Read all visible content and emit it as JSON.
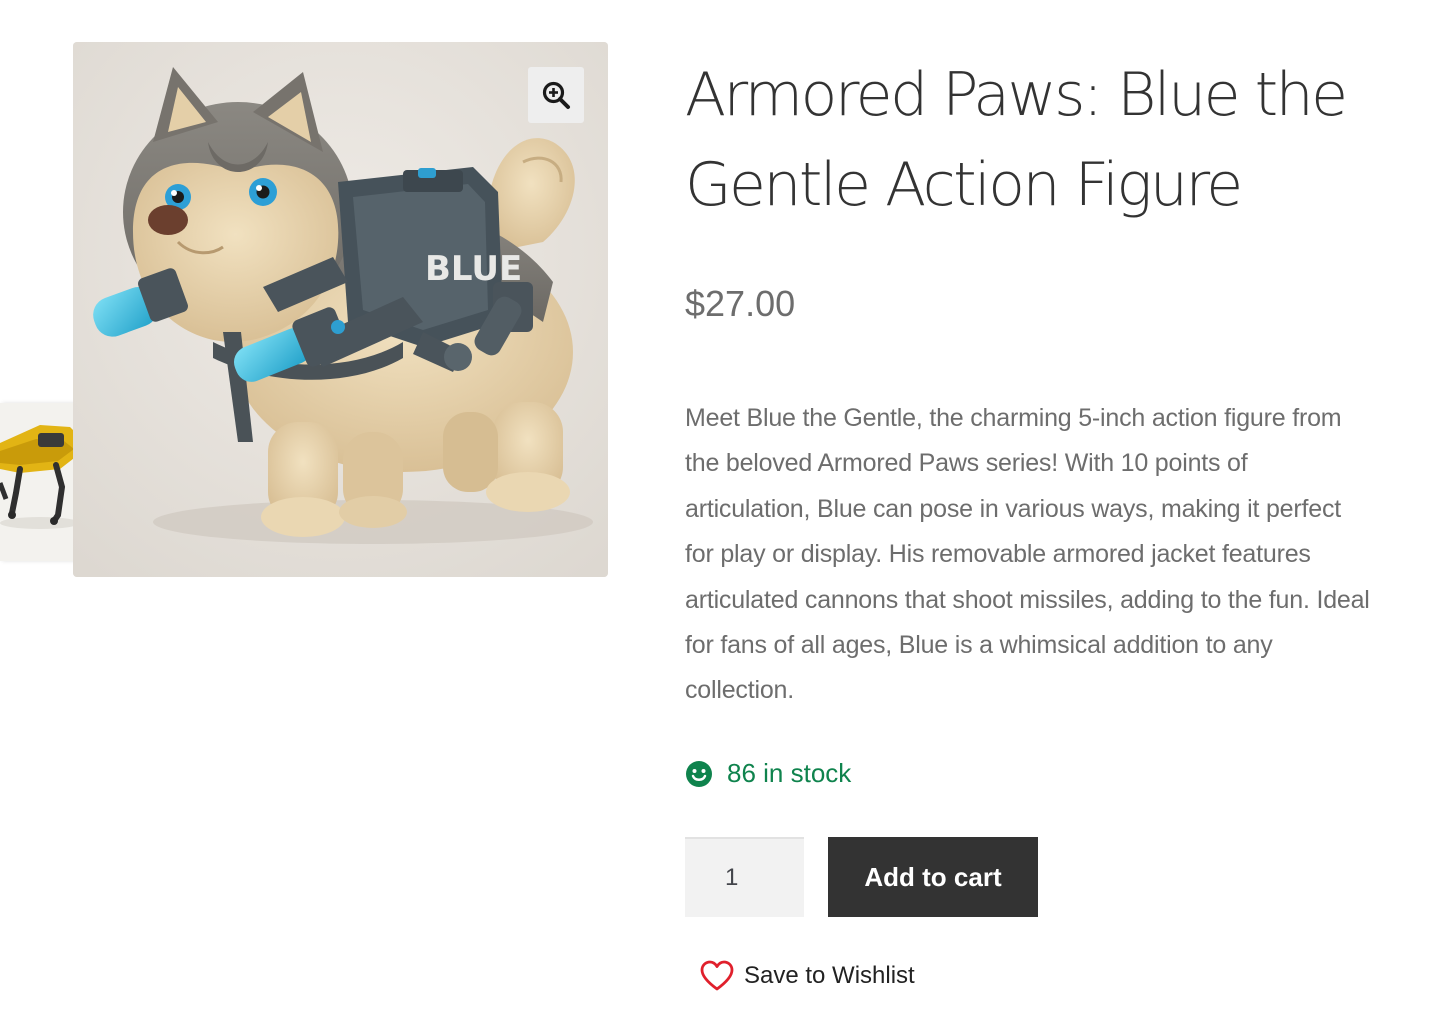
{
  "product": {
    "title": "Armored Paws: Blue the Gentle Action Figure",
    "price": "$27.00",
    "description": "Meet Blue the Gentle, the charming 5-inch action figure from the beloved Armored Paws series! With 10 points of articulation, Blue can pose in various ways, making it perfect for play or display. His removable armored jacket features articulated cannons that shoot missiles, adding to the fun. Ideal for fans of all ages, Blue is a whimsical addition to any collection.",
    "stock": "86 in stock",
    "jacket_label": "BLUE"
  },
  "cart": {
    "quantity": "1",
    "add_label": "Add to cart"
  },
  "wishlist": {
    "label": "Save to Wishlist"
  },
  "colors": {
    "stock_green": "#0f834d",
    "button_dark": "#333333",
    "heart_red": "#e0202c"
  },
  "icons": {
    "zoom": "zoom-in-icon",
    "stock": "smiley-icon",
    "wishlist": "heart-icon"
  }
}
